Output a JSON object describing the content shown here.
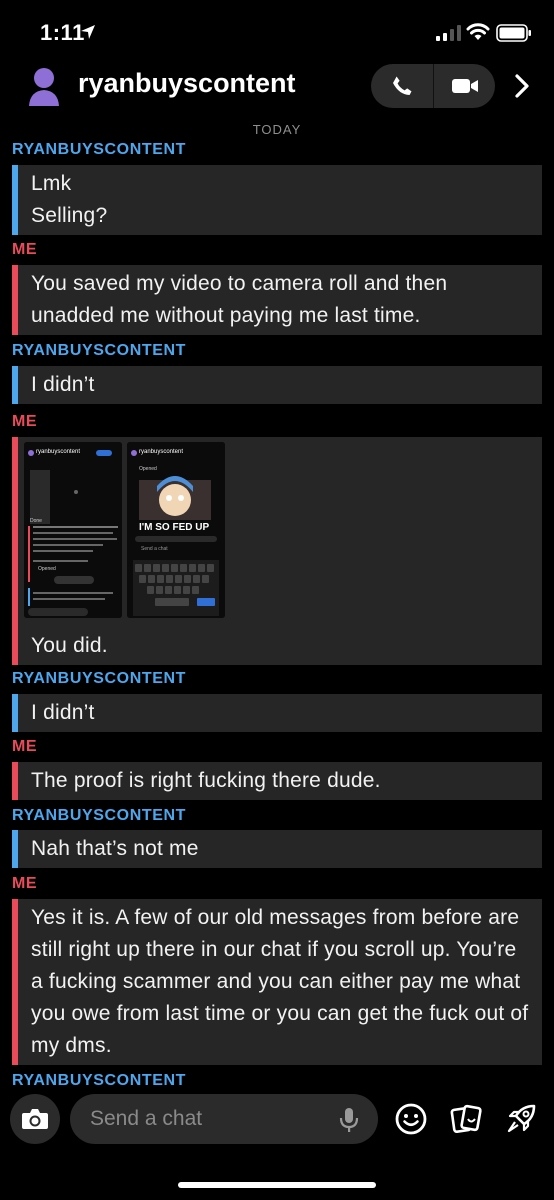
{
  "status_bar": {
    "time": "1:11"
  },
  "header": {
    "contact_name": "ryanbuyscontent"
  },
  "day_label": "TODAY",
  "labels": {
    "them": "RYANBUYSCONTENT",
    "me": "ME"
  },
  "messages": [
    {
      "from": "them",
      "text": "Lmk\nSelling?"
    },
    {
      "from": "me",
      "text": "You saved my video to camera roll and then unadded me without paying me last time."
    },
    {
      "from": "them",
      "text": "I didn’t"
    },
    {
      "from": "me",
      "text": "You did.",
      "attachments": [
        "screenshot",
        "screenshot"
      ]
    },
    {
      "from": "them",
      "text": "I didn’t"
    },
    {
      "from": "me",
      "text": "The proof is right fucking there dude."
    },
    {
      "from": "them",
      "text": "Nah that’s not me"
    },
    {
      "from": "me",
      "text": "Yes it is. A few of our old messages from before are still right up there in our chat if you scroll up. You’re a fucking scammer and you can either pay me what you owe from last time or you can get the fuck out of my dms."
    },
    {
      "from": "them",
      "text": ""
    }
  ],
  "attachment_content": {
    "shot1": {
      "header_name": "ryanbuyscontent",
      "note_label": "Done",
      "opened_label": "Opened"
    },
    "shot2": {
      "header_name": "ryanbuyscontent",
      "opened_label": "Opened",
      "meme_caption": "I'M SO FED UP",
      "input_placeholder": "Send a chat"
    }
  },
  "composer": {
    "placeholder": "Send a chat"
  },
  "icons": [
    "location-arrow-icon",
    "signal-icon",
    "wifi-icon",
    "battery-icon",
    "avatar-icon",
    "phone-icon",
    "video-icon",
    "chevron-right-icon",
    "camera-icon",
    "microphone-icon",
    "smiley-icon",
    "cards-icon",
    "rocket-icon"
  ],
  "colors": {
    "them": "#4ea6ec",
    "me": "#ea4b5a",
    "bubble": "#262626",
    "background": "#000000"
  }
}
